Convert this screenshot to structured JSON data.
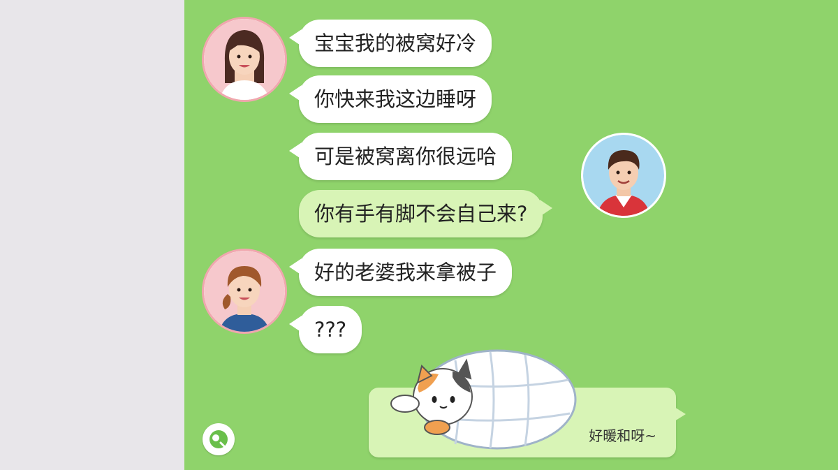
{
  "messages": [
    {
      "sender": "her",
      "text": "宝宝我的被窝好冷"
    },
    {
      "sender": "her",
      "text": "你快来我这边睡呀"
    },
    {
      "sender": "her",
      "text": "可是被窝离你很远哈"
    },
    {
      "sender": "him",
      "text": "你有手有脚不会自己来?"
    },
    {
      "sender": "her2",
      "text": "好的老婆我来拿被子"
    },
    {
      "sender": "her2",
      "text": "???"
    }
  ],
  "sticker": {
    "caption": "好暖和呀~"
  },
  "icons": {
    "emoji": "sticker-face-icon",
    "cat": "cat-in-blanket-icon"
  },
  "colors": {
    "chat_bg": "#8fd36b",
    "left_panel": "#e8e6ea",
    "incoming": "#ffffff",
    "outgoing": "#d8f4b6",
    "avatar_border": "#f0a7ae"
  }
}
